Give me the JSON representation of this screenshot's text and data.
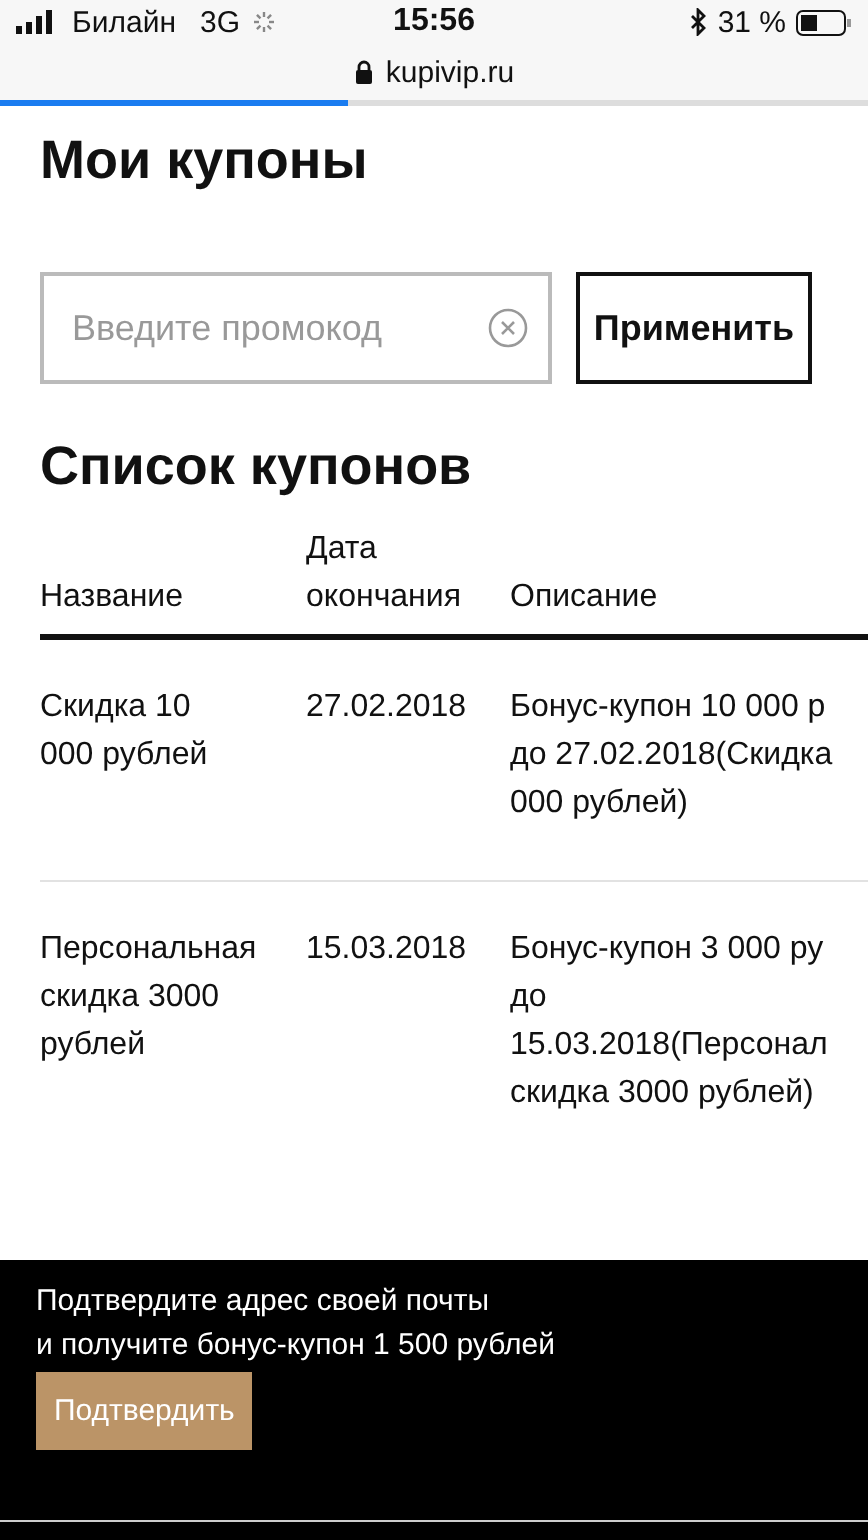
{
  "status_bar": {
    "carrier": "Билайн",
    "network": "3G",
    "time": "15:56",
    "battery": "31 %"
  },
  "address_bar": {
    "url": "kupivip.ru",
    "level": 0.4
  },
  "title": "Мои купоны",
  "promo": {
    "placeholder": "Введите промокод",
    "button": "Применить"
  },
  "list_title": "Список купонов",
  "table": {
    "columns": [
      "Название",
      "Дата окончания",
      "Описание"
    ],
    "rows": [
      [
        [
          "Скидка 10",
          "000 рублей"
        ],
        [
          "27.02.2018"
        ],
        [
          "Бонус-купон 10 000 р",
          "до 27.02.2018(Скидка",
          "000 рублей)"
        ]
      ],
      [
        [
          "Персональная",
          "скидка 3000",
          "рублей"
        ],
        [
          "15.03.2018"
        ],
        [
          "Бонус-купон 3 000 ру",
          "до",
          "15.03.2018(Персонал",
          "скидка 3000 рублей)"
        ]
      ]
    ]
  },
  "banner": {
    "lines": [
      "Подтвердите адрес своей почты",
      "и получите бонус-купон 1 500 рублей"
    ],
    "button": "Подтвердить"
  }
}
